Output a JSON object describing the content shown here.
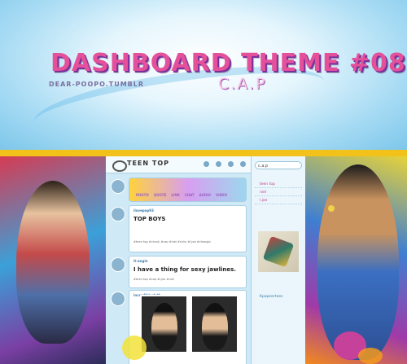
{
  "header": {
    "title": "DASHBOARD THEME #08",
    "subtitle": "C.A.P",
    "credit": "DEAR-POOPO.TUMBLR"
  },
  "dashboard": {
    "brand": "TEEN TOP",
    "post_buttons": [
      "PHOTO",
      "QUOTE",
      "LINK",
      "CHAT",
      "AUDIO",
      "VIDEO"
    ],
    "posts": [
      {
        "author": "ilovepop93",
        "title": "TOP BOYS",
        "body": "#teen top #chunji #cap #niel #ricky #l.joe #changjo"
      },
      {
        "author": "it-angie",
        "title": "I have a thing for sexy jawlines.",
        "body": "#teen top #cap #l.joe #niel"
      },
      {
        "author": "incrediblecloth",
        "title": "",
        "body": ""
      }
    ],
    "sidebar": {
      "search_value": "c.a.p",
      "items": [
        "teen top",
        "niel",
        "l.joe"
      ],
      "footer": "Kpopeertees"
    }
  },
  "colors": {
    "title_pink": "#e4519a",
    "accent_purple": "#7b2f9c",
    "bar_yellow": "#f2c21a"
  }
}
